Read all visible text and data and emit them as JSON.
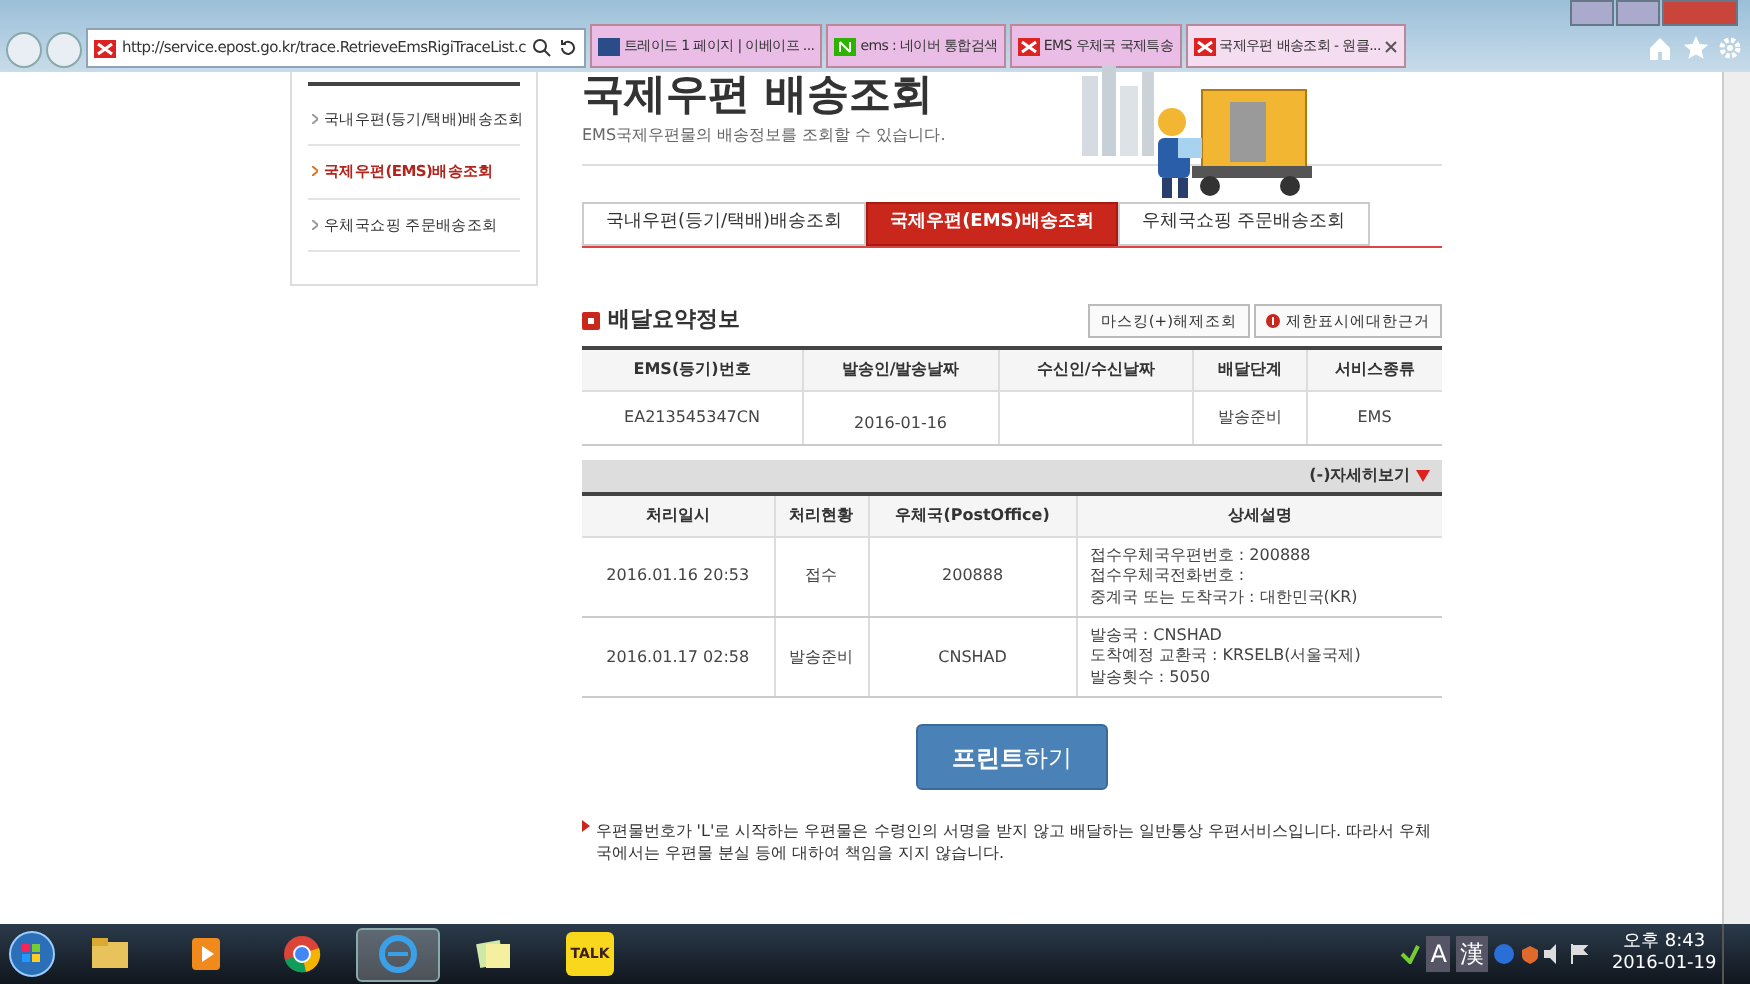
{
  "browser": {
    "address": "http://service.epost.go.kr/trace.RetrieveEmsRigiTraceList.c",
    "tabs": [
      {
        "label": "트레이드 1 페이지 | 이베이프 ...",
        "selected": false,
        "kind": "blue"
      },
      {
        "label": "ems : 네이버 통합검색",
        "selected": false,
        "kind": "green"
      },
      {
        "label": "EMS 우체국 국제특송",
        "selected": false,
        "kind": "post"
      },
      {
        "label": "국제우편 배송조회 - 원클...",
        "selected": true,
        "kind": "post"
      }
    ]
  },
  "sidebar": {
    "items": [
      {
        "label": "국내우편(등기/택배)배송조회",
        "selected": false
      },
      {
        "label": "국제우편(EMS)배송조회",
        "selected": true
      },
      {
        "label": "우체국쇼핑 주문배송조회",
        "selected": false
      }
    ]
  },
  "page": {
    "title": "국제우편 배송조회",
    "subtitle": "EMS국제우편물의 배송정보를 조회할 수 있습니다."
  },
  "tabs": [
    {
      "label": "국내우편(등기/택배)배송조회",
      "selected": false
    },
    {
      "label": "국제우편(EMS)배송조회",
      "selected": true
    },
    {
      "label": "우체국쇼핑 주문배송조회",
      "selected": false
    }
  ],
  "summary": {
    "title": "배달요약정보",
    "buttons": [
      {
        "label": "마스킹(+)해제조회",
        "kind": "plain"
      },
      {
        "label": "제한표시에대한근거",
        "kind": "info"
      }
    ],
    "columns": [
      "EMS(등기)번호",
      "발송인/발송날짜",
      "수신인/수신날짜",
      "배달단계",
      "서비스종류"
    ],
    "rows": [
      [
        "EA213545347CN",
        "2016-01-16",
        "",
        "발송준비",
        "EMS"
      ]
    ]
  },
  "detail": {
    "toggle": "(-)자세히보기",
    "expanded": true,
    "columns": [
      "처리일시",
      "처리현황",
      "우체국(PostOffice)",
      "상세설명"
    ],
    "rows": [
      {
        "cells": [
          "2016.01.16 20:53",
          "접수",
          "200888"
        ],
        "lines": [
          "접수우체국우편번호 : 200888",
          "접수우체국전화번호 :",
          "중계국 또는 도착국가 : 대한민국(KR)"
        ]
      },
      {
        "cells": [
          "2016.01.17 02:58",
          "발송준비",
          "CNSHAD"
        ],
        "lines": [
          "발송국 : CNSHAD",
          "도착예정 교환국 : KRSELB(서울국제)",
          "발송횟수 : 5050"
        ]
      }
    ]
  },
  "print_button": "**프린트**하기",
  "notice": "우편물번호가 'L'로 시작하는 우편물은 수령인의 서명을 받지 않고 배달하는 일반통상 우편서비스입니다. 따라서 우체국에서는 우편물 분실 등에 대하여 책임을 지지 않습니다.",
  "taskbar": {
    "apps": [
      {
        "kind": "folder",
        "selected": false
      },
      {
        "kind": "media",
        "selected": false
      },
      {
        "kind": "chrome",
        "selected": false
      },
      {
        "kind": "ie",
        "selected": true
      },
      {
        "kind": "notes",
        "selected": false
      },
      {
        "kind": "talk",
        "label": "TALK",
        "selected": false
      }
    ],
    "tray": [
      "A",
      "漢"
    ],
    "time": "오후 8:43",
    "date": "2016-01-19"
  }
}
